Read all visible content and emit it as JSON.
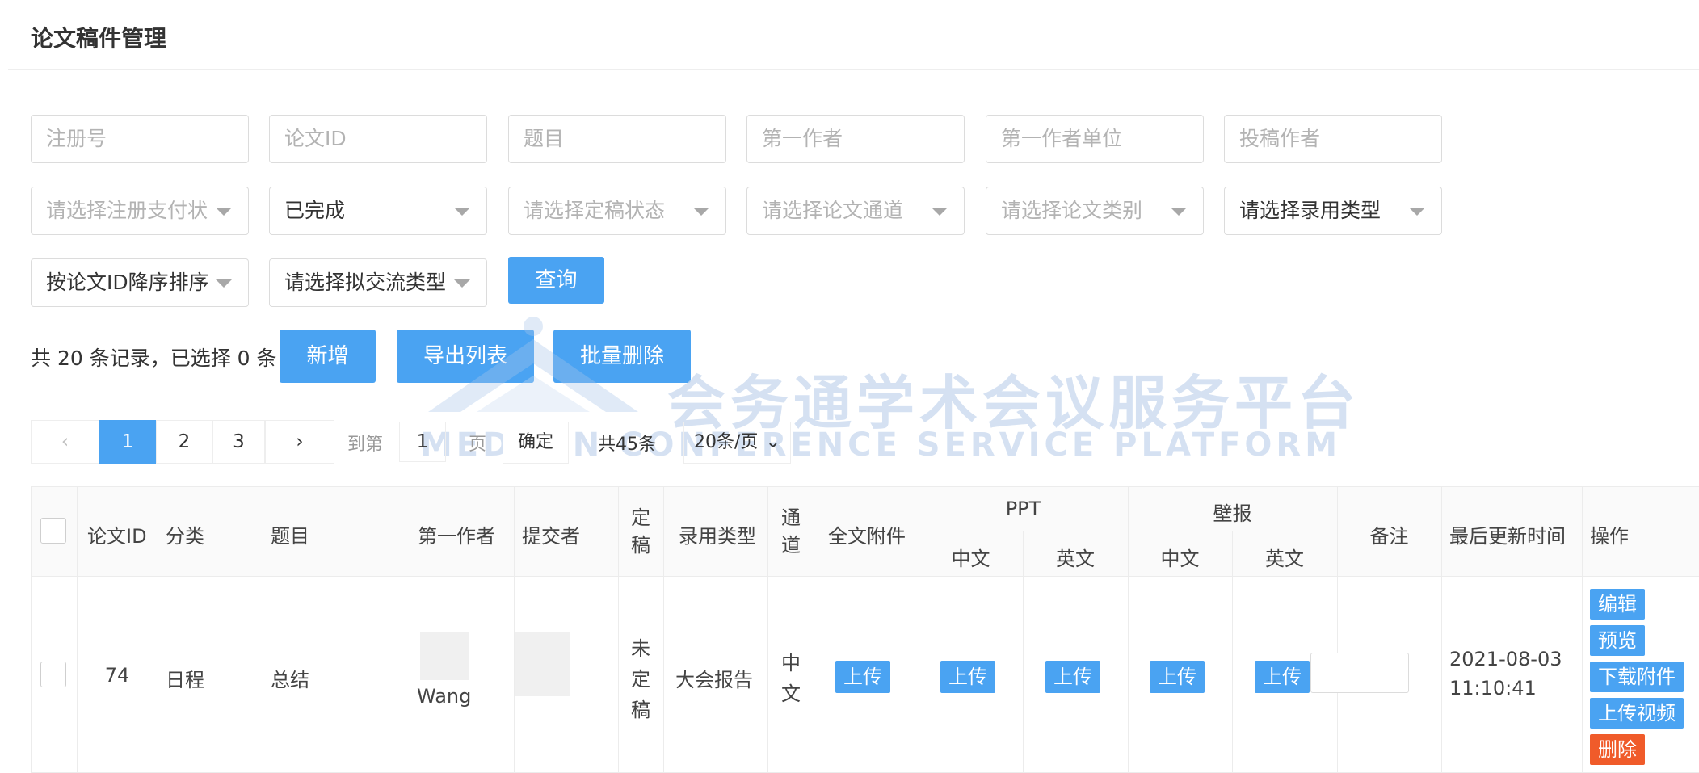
{
  "page_title": "论文稿件管理",
  "filters": {
    "row1": [
      "注册号",
      "论文ID",
      "题目",
      "第一作者",
      "第一作者单位",
      "投稿作者"
    ],
    "payment_status_placeholder": "请选择注册支付状",
    "status_value": "已完成",
    "final_status_placeholder": "请选择定稿状态",
    "channel_placeholder": "请选择论文通道",
    "category_placeholder": "请选择论文类别",
    "accept_type_value": "请选择录用类型",
    "sort_value": "按论文ID降序排序",
    "exchange_type_value": "请选择拟交流类型",
    "query_button": "查询"
  },
  "summary": "共 20 条记录，已选择 0 条",
  "toolbar": {
    "add": "新增",
    "export": "导出列表",
    "batch_delete": "批量删除"
  },
  "watermark": {
    "cn": "会务通学术会议服务平台",
    "en": "MEDCON CONFERENCE SERVICE PLATFORM"
  },
  "pagination": {
    "prev": "‹",
    "pages": [
      "1",
      "2",
      "3"
    ],
    "next": "›",
    "goto_label": "到第",
    "goto_value": "1",
    "page_unit": "页",
    "confirm": "确定",
    "total": "共45条",
    "page_size": "20条/页"
  },
  "table": {
    "headers": {
      "id": "论文ID",
      "category": "分类",
      "title": "题目",
      "first_author": "第一作者",
      "submitter": "提交者",
      "final": "定稿",
      "accept_type": "录用类型",
      "channel": "通道",
      "full_attachment": "全文附件",
      "ppt": "PPT",
      "poster": "壁报",
      "cn": "中文",
      "en": "英文",
      "remark": "备注",
      "updated": "最后更新时间",
      "actions": "操作"
    },
    "rows": [
      {
        "id": "74",
        "category": "日程",
        "title": "总结",
        "first_author": "Wang",
        "final": "未定稿",
        "accept_type": "大会报告",
        "channel": "中文",
        "upload": "上传",
        "updated_date": "2021-08-03",
        "updated_time": "11:10:41",
        "actions": [
          "编辑",
          "预览",
          "下载附件",
          "上传视频",
          "删除"
        ]
      }
    ]
  }
}
